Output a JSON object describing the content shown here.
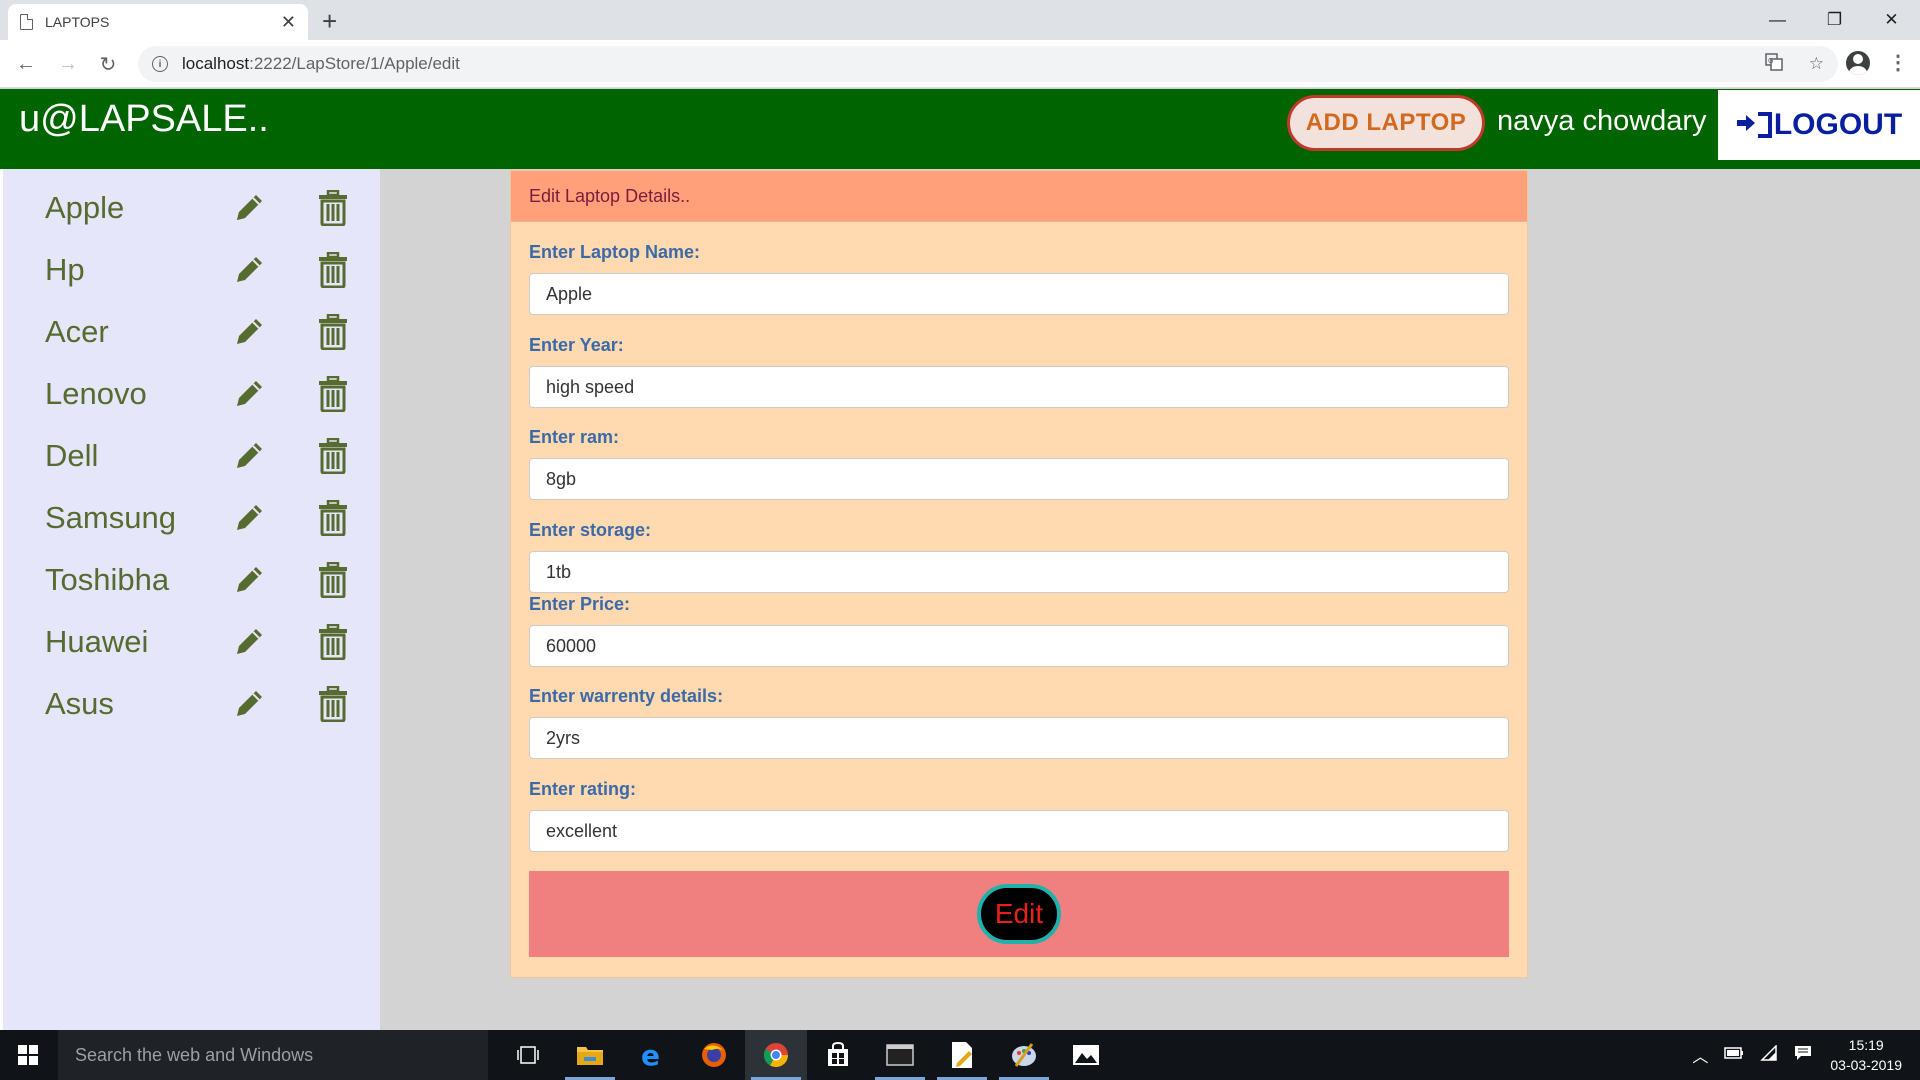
{
  "browser": {
    "tab_title": "LAPTOPS",
    "tab_close": "✕",
    "new_tab": "+",
    "url_host": "localhost",
    "url_path": ":2222/LapStore/1/Apple/edit",
    "window_controls": [
      "—",
      "❐",
      "✕"
    ]
  },
  "header": {
    "brand": "u@LAPSALE..",
    "add_button": "ADD LAPTOP",
    "user_name": "navya chowdary",
    "logout_label": "LOGOUT"
  },
  "sidebar": {
    "items": [
      {
        "label": "Apple"
      },
      {
        "label": "Hp"
      },
      {
        "label": "Acer"
      },
      {
        "label": "Lenovo"
      },
      {
        "label": "Dell"
      },
      {
        "label": "Samsung"
      },
      {
        "label": "Toshibha"
      },
      {
        "label": "Huawei"
      },
      {
        "label": "Asus"
      }
    ]
  },
  "form": {
    "header": "Edit Laptop Details..",
    "fields": [
      {
        "label": "Enter Laptop Name:",
        "value": "Apple"
      },
      {
        "label": "Enter Year:",
        "value": "high speed"
      },
      {
        "label": "Enter ram:",
        "value": "8gb"
      },
      {
        "label": "Enter storage:",
        "value": "1tb"
      },
      {
        "label": "Enter Price:",
        "value": "60000"
      },
      {
        "label": "Enter warrenty details:",
        "value": "2yrs"
      },
      {
        "label": "Enter rating:",
        "value": "excellent"
      }
    ],
    "submit_label": "Edit"
  },
  "taskbar": {
    "search_placeholder": "Search the web and Windows",
    "time": "15:19",
    "date": "03-03-2019"
  },
  "colors": {
    "header_bg": "#006400",
    "sidebar_bg": "#e6e6fa",
    "card_bg": "#ffdab0",
    "card_header_bg": "#ffa07a",
    "submit_bar_bg": "#f08080",
    "sidebar_text": "#556b2f"
  }
}
